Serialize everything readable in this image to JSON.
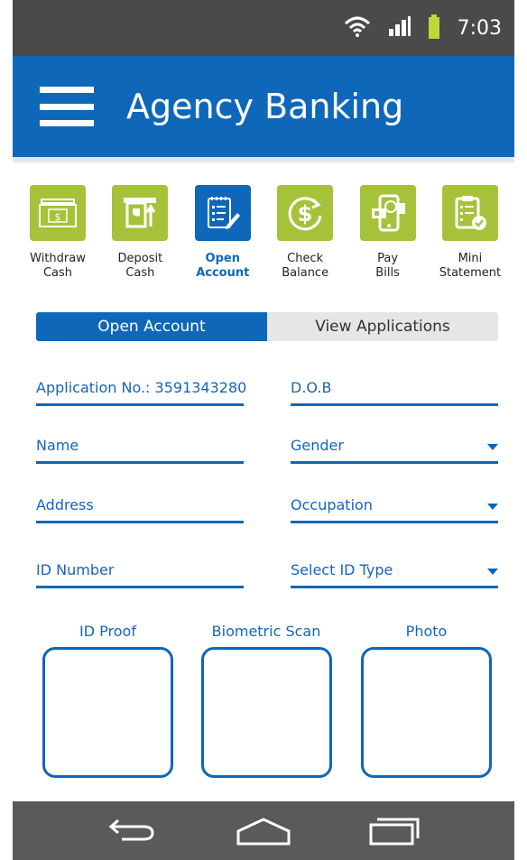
{
  "status": {
    "time": "7:03",
    "icons": [
      "wifi-icon",
      "signal-icon",
      "battery-icon"
    ]
  },
  "appbar": {
    "title": "Agency Banking",
    "menu_icon": "hamburger-menu-icon"
  },
  "actions": [
    {
      "label": "Withdraw\nCash",
      "icon": "cash-icon",
      "active": false
    },
    {
      "label": "Deposit\nCash",
      "icon": "deposit-icon",
      "active": false
    },
    {
      "label": "Open\nAccount",
      "icon": "form-icon",
      "active": true
    },
    {
      "label": "Check\nBalance",
      "icon": "dollar-refresh-icon",
      "active": false
    },
    {
      "label": "Pay\nBills",
      "icon": "mobile-pay-icon",
      "active": false
    },
    {
      "label": "Mini\nStatement",
      "icon": "statement-icon",
      "active": false
    }
  ],
  "tabs": {
    "open_account": "Open Account",
    "view_applications": "View Applications"
  },
  "form": {
    "application_no": "Application No.: 3591343280",
    "dob": "D.O.B",
    "name": "Name",
    "gender": "Gender",
    "address": "Address",
    "occupation": "Occupation",
    "id_number": "ID Number",
    "id_type": "Select ID Type"
  },
  "uploads": {
    "id_proof": "ID Proof",
    "biometric": "Biometric Scan",
    "photo": "Photo"
  },
  "colors": {
    "primary": "#0e67b8",
    "accent": "#a6c23a",
    "statusbar": "#4a4a4a",
    "navbar": "#5a5a5a"
  },
  "navbar": {
    "icons": [
      "back-icon",
      "home-icon",
      "recents-icon"
    ]
  }
}
